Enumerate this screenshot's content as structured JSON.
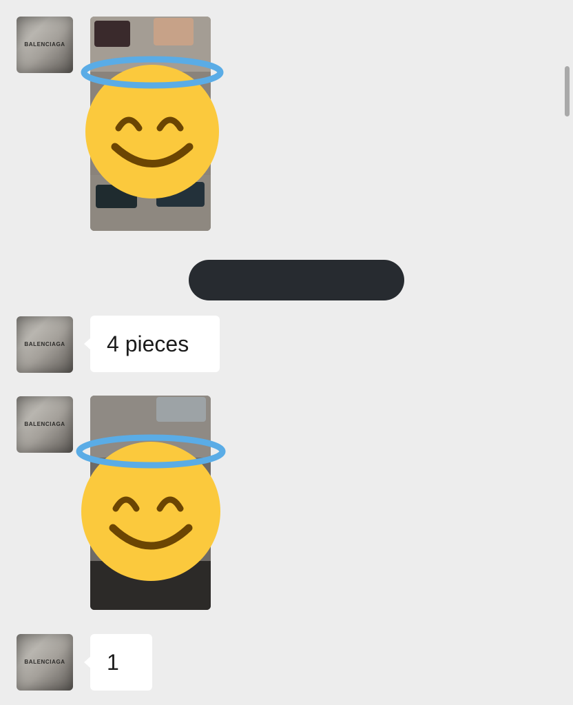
{
  "contact": {
    "avatar_text": "BALENCIAGA"
  },
  "messages": [
    {
      "type": "image",
      "icon": "smiling-face-with-halo-icon"
    },
    {
      "type": "text",
      "text": "4 pieces"
    },
    {
      "type": "image",
      "icon": "smiling-face-with-halo-icon"
    },
    {
      "type": "text",
      "text": "1"
    }
  ],
  "colors": {
    "background": "#ededed",
    "bubble": "#ffffff",
    "pill": "#272b30",
    "emoji_face": "#fbc93d",
    "emoji_halo": "#5aace6",
    "emoji_features": "#6b4503"
  }
}
